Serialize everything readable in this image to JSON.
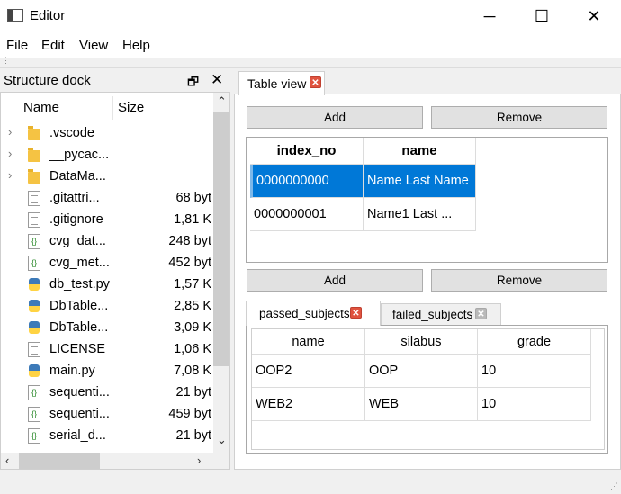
{
  "window": {
    "title": "Editor",
    "minimize": "─",
    "maximize": "☐",
    "close": "✕"
  },
  "menu": [
    "File",
    "Edit",
    "View",
    "Help"
  ],
  "dock": {
    "title": "Structure dock",
    "float_glyph": "🗗",
    "close_glyph": "✕",
    "columns": [
      "Name",
      "Size"
    ],
    "items": [
      {
        "name": ".vscode",
        "size": "",
        "icon": "folder-icon",
        "expandable": true
      },
      {
        "name": "__pycac...",
        "size": "",
        "icon": "folder-icon",
        "expandable": true
      },
      {
        "name": "DataMa...",
        "size": "",
        "icon": "folder-icon",
        "expandable": true
      },
      {
        "name": ".gitattri...",
        "size": "68 byt",
        "icon": "text-file-icon",
        "expandable": false
      },
      {
        "name": ".gitignore",
        "size": "1,81 K",
        "icon": "text-file-icon",
        "expandable": false
      },
      {
        "name": "cvg_dat...",
        "size": "248 byt",
        "icon": "json-file-icon",
        "expandable": false
      },
      {
        "name": "cvg_met...",
        "size": "452 byt",
        "icon": "json-file-icon",
        "expandable": false
      },
      {
        "name": "db_test.py",
        "size": "1,57 K",
        "icon": "python-file-icon",
        "expandable": false
      },
      {
        "name": "DbTable...",
        "size": "2,85 K",
        "icon": "python-file-icon",
        "expandable": false
      },
      {
        "name": "DbTable...",
        "size": "3,09 K",
        "icon": "python-file-icon",
        "expandable": false
      },
      {
        "name": "LICENSE",
        "size": "1,06 K",
        "icon": "blank-file-icon",
        "expandable": false
      },
      {
        "name": "main.py",
        "size": "7,08 K",
        "icon": "python-file-icon",
        "expandable": false
      },
      {
        "name": "sequenti...",
        "size": "21 byt",
        "icon": "json-file-icon",
        "expandable": false
      },
      {
        "name": "sequenti...",
        "size": "459 byt",
        "icon": "json-file-icon",
        "expandable": false
      },
      {
        "name": "serial_d...",
        "size": "21 byt",
        "icon": "json-file-icon",
        "expandable": false
      }
    ]
  },
  "tabs": [
    {
      "label": "Table view",
      "close": "✕"
    }
  ],
  "top_buttons": {
    "add": "Add",
    "remove": "Remove"
  },
  "main_table": {
    "columns": [
      "index_no",
      "name"
    ],
    "rows": [
      [
        "0000000000",
        "Name Last Name"
      ],
      [
        "0000000001",
        "Name1 Last ..."
      ]
    ],
    "selected_row": 0
  },
  "bottom_buttons": {
    "add": "Add",
    "remove": "Remove"
  },
  "sub_tabs": [
    {
      "label": "passed_subjects",
      "close": "✕",
      "active": true
    },
    {
      "label": "failed_subjects",
      "close": "✕",
      "active": false
    }
  ],
  "sub_table": {
    "columns": [
      "name",
      "silabus",
      "grade"
    ],
    "rows": [
      [
        "OOP2",
        "OOP",
        "10"
      ],
      [
        "WEB2",
        "WEB",
        "10"
      ]
    ]
  }
}
